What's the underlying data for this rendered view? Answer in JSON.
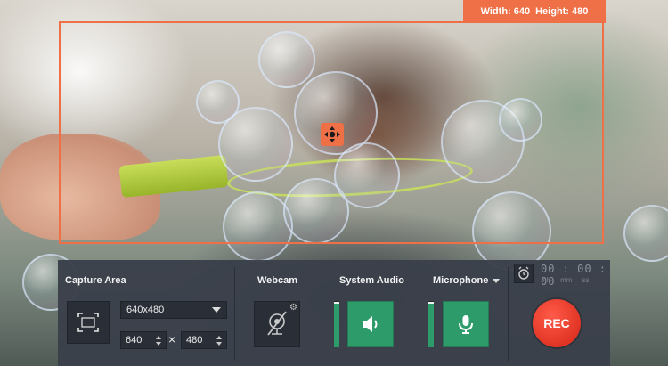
{
  "capture_size_label": {
    "width_label": "Width: 640",
    "height_label": "Height: 480"
  },
  "panel": {
    "capture_area": {
      "title": "Capture Area",
      "preset_value": "640x480",
      "width_value": "640",
      "times_symbol": "×",
      "height_value": "480"
    },
    "webcam": {
      "title": "Webcam"
    },
    "system_audio": {
      "title": "System Audio",
      "level": 0.95
    },
    "microphone": {
      "title": "Microphone",
      "level": 0.95
    },
    "timer": {
      "display": "00 : 00 : 00",
      "units": "hh mm ss"
    },
    "rec_label": "REC"
  },
  "colors": {
    "accent": "#ef6f47",
    "panel": "#3a404a",
    "green": "#2e9b6b",
    "rec": "#e13424"
  },
  "icons": [
    "move-arrows-icon",
    "fullscreen-capture-icon",
    "webcam-off-icon",
    "gear-icon",
    "speaker-icon",
    "microphone-icon",
    "alarm-clock-icon"
  ]
}
